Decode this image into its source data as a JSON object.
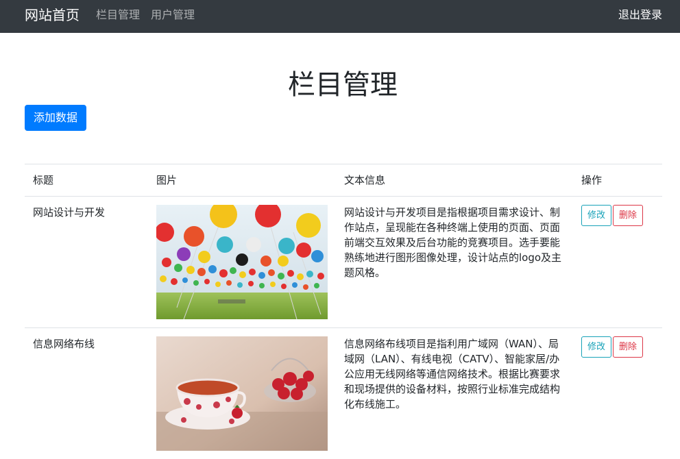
{
  "navbar": {
    "brand": "网站首页",
    "links": [
      "栏目管理",
      "用户管理"
    ],
    "logout": "退出登录"
  },
  "main": {
    "title": "栏目管理",
    "add_button": "添加数据"
  },
  "table": {
    "headers": [
      "标题",
      "图片",
      "文本信息",
      "操作"
    ],
    "rows": [
      {
        "title": "网站设计与开发",
        "image": "balloons-photo",
        "text": "网站设计与开发项目是指根据项目需求设计、制作站点，呈现能在各种终端上使用的页面、页面前端交互效果及后台功能的竞赛项目。选手要能熟练地进行图形图像处理，设计站点的logo及主题风格。",
        "edit": "修改",
        "delete": "删除"
      },
      {
        "title": "信息网络布线",
        "image": "teacup-strawberries-photo",
        "text": "信息网络布线项目是指利用广域网（WAN）、局域网（LAN）、有线电视（CATV）、智能家居/办公应用无线网络等通信网络技术。根据比赛要求和现场提供的设备材料，按照行业标准完成结构化布线施工。",
        "edit": "修改",
        "delete": "删除"
      }
    ]
  }
}
